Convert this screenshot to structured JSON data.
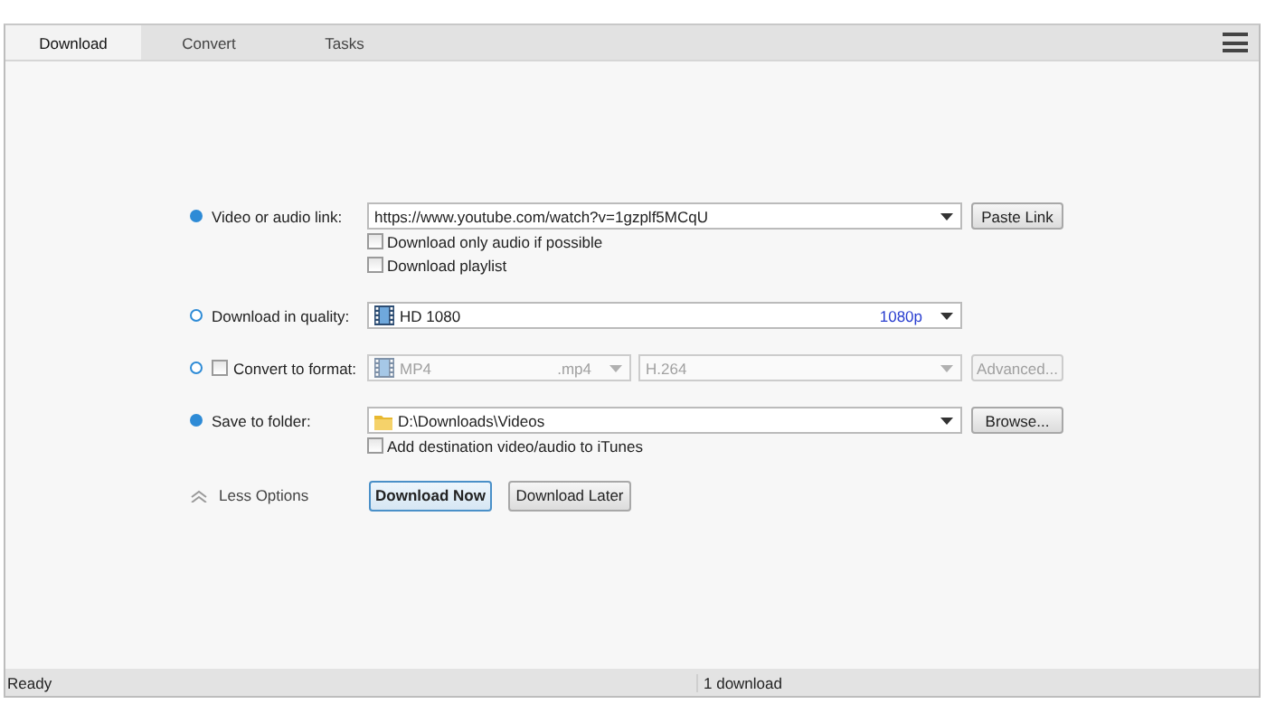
{
  "tabs": [
    {
      "label": "Download",
      "selected": true
    },
    {
      "label": "Convert",
      "selected": false
    },
    {
      "label": "Tasks",
      "selected": false
    }
  ],
  "form": {
    "link": {
      "label": "Video or audio link:",
      "active": true,
      "value": "https://www.youtube.com/watch?v=1gzplf5MCqU",
      "button": "Paste Link",
      "options": [
        {
          "label": "Download only audio if possible",
          "checked": false
        },
        {
          "label": "Download playlist",
          "checked": false
        }
      ]
    },
    "quality": {
      "label": "Download in quality:",
      "active": false,
      "value": "HD 1080",
      "badge": "1080p"
    },
    "format": {
      "label": "Convert to format:",
      "active": false,
      "checked": false,
      "format": "MP4",
      "extension": ".mp4",
      "codec": "H.264",
      "button": "Advanced..."
    },
    "folder": {
      "label": "Save to folder:",
      "active": true,
      "value": "D:\\Downloads\\Videos",
      "button": "Browse...",
      "options": [
        {
          "label": "Add destination video/audio to iTunes",
          "checked": false
        }
      ]
    },
    "less_options": "Less Options",
    "buttons": [
      {
        "label": "Download Now",
        "default": true
      },
      {
        "label": "Download Later",
        "default": false
      }
    ]
  },
  "status_bar": {
    "left": "Ready",
    "right": "1 download"
  }
}
